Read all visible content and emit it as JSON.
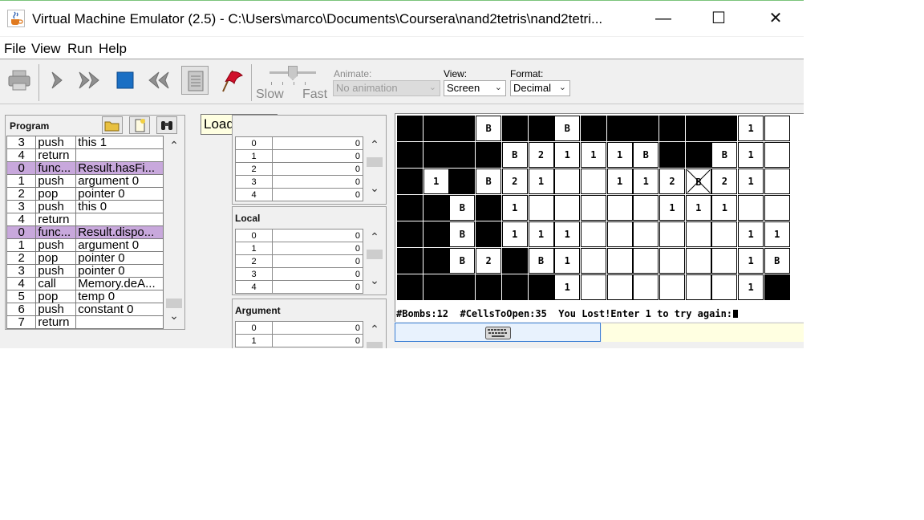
{
  "window": {
    "title": "Virtual Machine Emulator (2.5) - C:\\Users\\marco\\Documents\\Coursera\\nand2tetris\\nand2tetri...",
    "minimize": "—",
    "maximize": "☐",
    "close": "✕"
  },
  "menu": [
    "File",
    "View",
    "Run",
    "Help"
  ],
  "toolbar": {
    "speed_slow": "Slow",
    "speed_fast": "Fast",
    "animate_label": "Animate:",
    "animate_value": "No animation",
    "view_label": "View:",
    "view_value": "Screen",
    "format_label": "Format:",
    "format_value": "Decimal",
    "tooltip": "Load Script"
  },
  "program": {
    "title": "Program",
    "rows": [
      {
        "n": "3",
        "cmd": "push",
        "arg": "this 1",
        "hl": false
      },
      {
        "n": "4",
        "cmd": "return",
        "arg": "",
        "hl": false
      },
      {
        "n": "0",
        "cmd": "func...",
        "arg": "Result.hasFi...",
        "hl": true
      },
      {
        "n": "1",
        "cmd": "push",
        "arg": "argument 0",
        "hl": false
      },
      {
        "n": "2",
        "cmd": "pop",
        "arg": "pointer 0",
        "hl": false
      },
      {
        "n": "3",
        "cmd": "push",
        "arg": "this 0",
        "hl": false
      },
      {
        "n": "4",
        "cmd": "return",
        "arg": "",
        "hl": false
      },
      {
        "n": "0",
        "cmd": "func...",
        "arg": "Result.dispo...",
        "hl": true
      },
      {
        "n": "1",
        "cmd": "push",
        "arg": "argument 0",
        "hl": false
      },
      {
        "n": "2",
        "cmd": "pop",
        "arg": "pointer 0",
        "hl": false
      },
      {
        "n": "3",
        "cmd": "push",
        "arg": "pointer 0",
        "hl": false
      },
      {
        "n": "4",
        "cmd": "call",
        "arg": "Memory.deA...",
        "hl": false
      },
      {
        "n": "5",
        "cmd": "pop",
        "arg": "temp 0",
        "hl": false
      },
      {
        "n": "6",
        "cmd": "push",
        "arg": "constant 0",
        "hl": false
      },
      {
        "n": "7",
        "cmd": "return",
        "arg": "",
        "hl": false
      }
    ]
  },
  "segments": {
    "stack_rows": [
      [
        "0",
        "0"
      ],
      [
        "1",
        "0"
      ],
      [
        "2",
        "0"
      ],
      [
        "3",
        "0"
      ],
      [
        "4",
        "0"
      ]
    ],
    "local_title": "Local",
    "local_rows": [
      [
        "0",
        "0"
      ],
      [
        "1",
        "0"
      ],
      [
        "2",
        "0"
      ],
      [
        "3",
        "0"
      ],
      [
        "4",
        "0"
      ]
    ],
    "argument_title": "Argument",
    "argument_rows": [
      [
        "0",
        "0"
      ],
      [
        "1",
        "0"
      ]
    ]
  },
  "screen": {
    "grid": [
      [
        "#",
        "#",
        "#",
        "B",
        "#",
        "#",
        "B",
        "#",
        "#",
        "#",
        "#",
        "#",
        "#",
        "1",
        "."
      ],
      [
        "#",
        "#",
        "#",
        "#",
        "B",
        "2",
        "1",
        "1",
        "1",
        "B",
        "#",
        "#",
        "B",
        "1",
        "."
      ],
      [
        "#",
        "1",
        "#",
        "B",
        "2",
        "1",
        ".",
        ".",
        "1",
        "1",
        "2",
        "X",
        "2",
        "1",
        "."
      ],
      [
        "#",
        "#",
        "B",
        "#",
        "1",
        ".",
        ".",
        ".",
        ".",
        ".",
        "1",
        "1",
        "1",
        ".",
        "."
      ],
      [
        "#",
        "#",
        "B",
        "#",
        "1",
        "1",
        "1",
        ".",
        ".",
        ".",
        ".",
        ".",
        ".",
        "1",
        "1"
      ],
      [
        "#",
        "#",
        "B",
        "2",
        "#",
        "B",
        "1",
        ".",
        ".",
        ".",
        ".",
        ".",
        ".",
        "1",
        "B"
      ],
      [
        "#",
        "#",
        "#",
        "#",
        "#",
        "#",
        "1",
        ".",
        ".",
        ".",
        ".",
        ".",
        ".",
        "1",
        "#"
      ]
    ],
    "status_text": "#Bombs:12  #CellsToOpen:35  You Lost!Enter 1 to try again:"
  }
}
